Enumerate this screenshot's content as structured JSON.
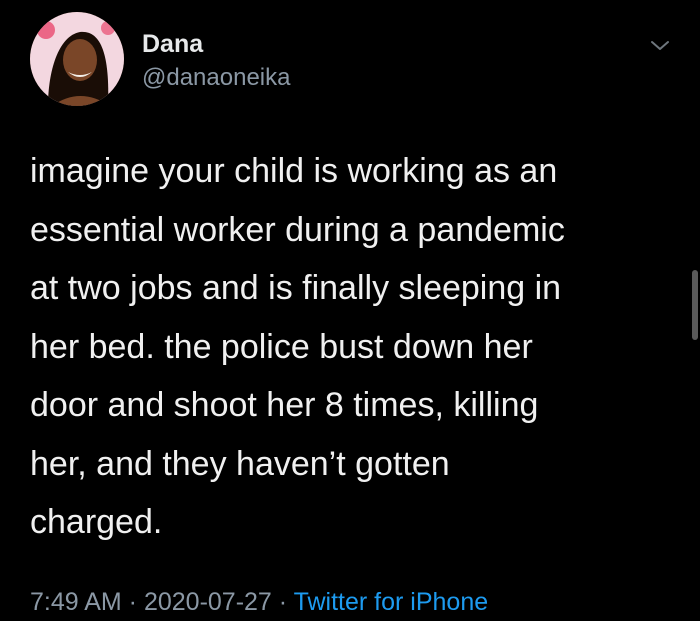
{
  "user": {
    "display_name": "Dana",
    "handle": "@danaoneika"
  },
  "tweet": {
    "text": "imagine your child is working as an\nessential worker during a pandemic\nat two jobs and is finally sleeping in\nher bed. the police bust down her\ndoor and shoot her 8 times, killing\nher, and they haven’t gotten\ncharged.",
    "time": "7:49 AM",
    "date": "2020-07-27",
    "separator": " · ",
    "source": "Twitter for iPhone"
  },
  "icons": {
    "avatar": "profile-photo",
    "menu": "chevron-down-icon"
  },
  "colors": {
    "background": "#000000",
    "name": "#e7e9ea",
    "secondary": "#8b98a5",
    "link": "#1d9bf0"
  }
}
